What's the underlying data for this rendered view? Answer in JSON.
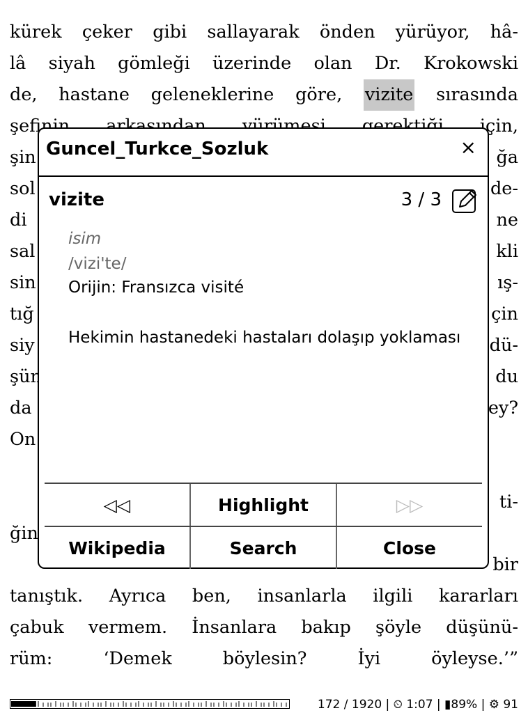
{
  "reader": {
    "lines": [
      [
        "kürek",
        "çeker",
        "gibi",
        "sallayarak",
        "önden",
        "yürüyor,",
        "hâ-"
      ],
      [
        "lâ",
        "siyah",
        "gömleği",
        "üzerinde",
        "olan",
        "Dr.",
        "Krokowski"
      ],
      [
        "de,",
        "hastane",
        "geleneklerine",
        "göre,",
        "vizite",
        "sırasında"
      ],
      [
        "şefinin",
        "arkasından",
        "yürümesi",
        "gerektiği",
        "için,"
      ],
      [
        "şin",
        "ğa"
      ],
      [
        "sol",
        "de-"
      ],
      [
        "di",
        "ne"
      ],
      [
        "sal",
        "kli"
      ],
      [
        "sin",
        "ış-"
      ],
      [
        "tığ",
        "çin"
      ],
      [
        "siy",
        "dü-"
      ],
      [
        "şün",
        "du"
      ],
      [
        "da",
        "ey?"
      ],
      [
        "On",
        ""
      ],
      [
        "",
        ""
      ],
      [
        "",
        "ti-"
      ],
      [
        "ğin",
        ""
      ],
      [
        "",
        "bir"
      ],
      [
        "tanıştık.",
        "Ayrıca",
        "ben,",
        "insanlarla",
        "ilgili",
        "kararları"
      ],
      [
        "çabuk",
        "vermem.",
        "İnsanlara",
        "bakıp",
        "şöyle",
        "düşünü-"
      ],
      [
        "rüm:",
        "‘Demek",
        "böylesin?",
        "İyi",
        "öyleyse.’”"
      ]
    ],
    "highlighted_word": "vizite"
  },
  "popup": {
    "dictionary_name": "Guncel_Turkce_Sozluk",
    "close_icon": "×",
    "headword": "vizite",
    "result_counter": "3 / 3",
    "part_of_speech": "isim",
    "pronunciation": "/vizi'te/",
    "origin": "Orijin: Fransızca visité",
    "definition": "Hekimin hastanedeki hastaları dolaşıp yoklaması",
    "buttons": {
      "prev": "◁◁",
      "highlight": "Highlight",
      "next": "▷▷",
      "wikipedia": "Wikipedia",
      "search": "Search",
      "close": "Close"
    }
  },
  "footer": {
    "progress_fraction": 0.0896,
    "page": "172 / 1920",
    "time": "1:07",
    "battery": "89%",
    "memory": "91",
    "status_text": "172 / 1920 | ⏲ 1:07 | ▮89% | ⚙ 91"
  }
}
